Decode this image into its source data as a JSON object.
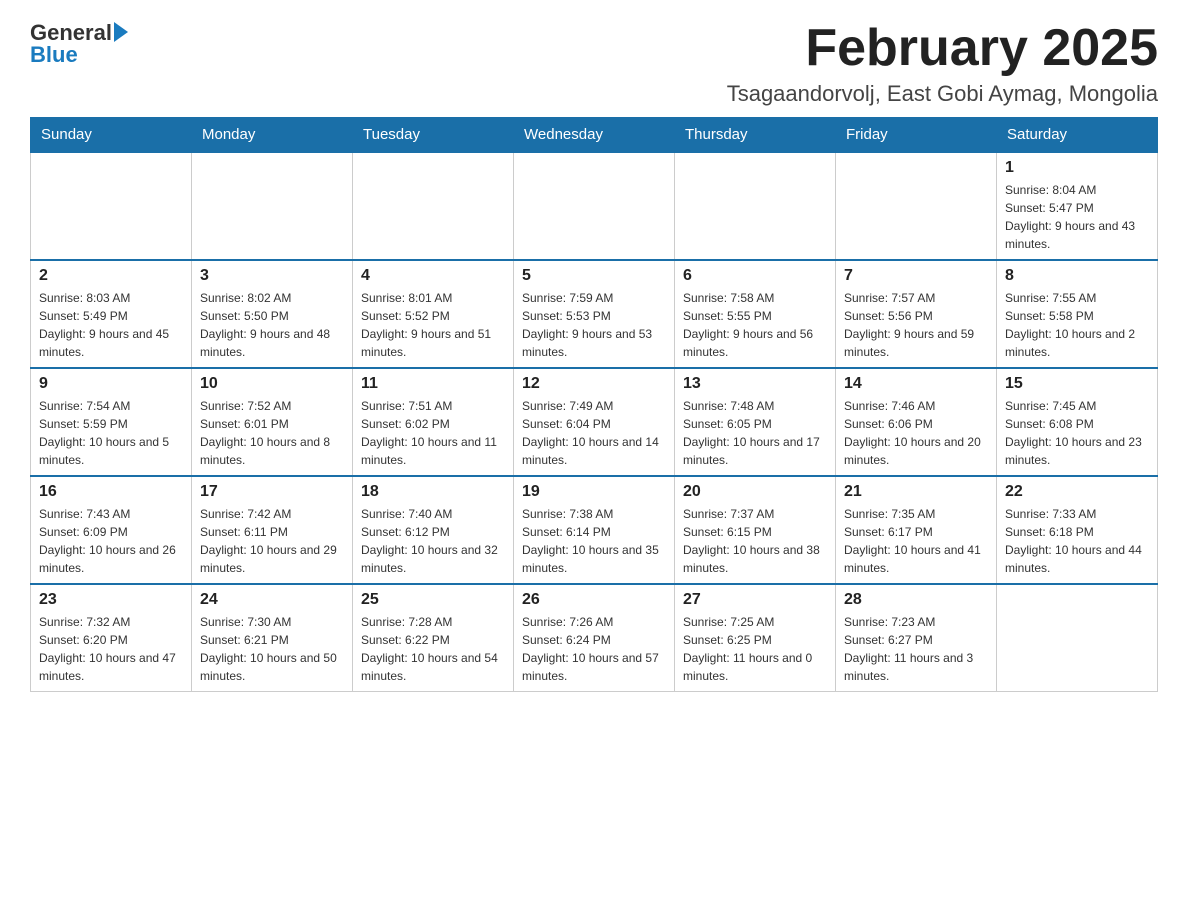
{
  "header": {
    "logo_text_general": "General",
    "logo_text_blue": "Blue",
    "month_title": "February 2025",
    "location": "Tsagaandorvolj, East Gobi Aymag, Mongolia"
  },
  "weekdays": [
    "Sunday",
    "Monday",
    "Tuesday",
    "Wednesday",
    "Thursday",
    "Friday",
    "Saturday"
  ],
  "weeks": [
    [
      {
        "day": "",
        "info": ""
      },
      {
        "day": "",
        "info": ""
      },
      {
        "day": "",
        "info": ""
      },
      {
        "day": "",
        "info": ""
      },
      {
        "day": "",
        "info": ""
      },
      {
        "day": "",
        "info": ""
      },
      {
        "day": "1",
        "info": "Sunrise: 8:04 AM\nSunset: 5:47 PM\nDaylight: 9 hours and 43 minutes."
      }
    ],
    [
      {
        "day": "2",
        "info": "Sunrise: 8:03 AM\nSunset: 5:49 PM\nDaylight: 9 hours and 45 minutes."
      },
      {
        "day": "3",
        "info": "Sunrise: 8:02 AM\nSunset: 5:50 PM\nDaylight: 9 hours and 48 minutes."
      },
      {
        "day": "4",
        "info": "Sunrise: 8:01 AM\nSunset: 5:52 PM\nDaylight: 9 hours and 51 minutes."
      },
      {
        "day": "5",
        "info": "Sunrise: 7:59 AM\nSunset: 5:53 PM\nDaylight: 9 hours and 53 minutes."
      },
      {
        "day": "6",
        "info": "Sunrise: 7:58 AM\nSunset: 5:55 PM\nDaylight: 9 hours and 56 minutes."
      },
      {
        "day": "7",
        "info": "Sunrise: 7:57 AM\nSunset: 5:56 PM\nDaylight: 9 hours and 59 minutes."
      },
      {
        "day": "8",
        "info": "Sunrise: 7:55 AM\nSunset: 5:58 PM\nDaylight: 10 hours and 2 minutes."
      }
    ],
    [
      {
        "day": "9",
        "info": "Sunrise: 7:54 AM\nSunset: 5:59 PM\nDaylight: 10 hours and 5 minutes."
      },
      {
        "day": "10",
        "info": "Sunrise: 7:52 AM\nSunset: 6:01 PM\nDaylight: 10 hours and 8 minutes."
      },
      {
        "day": "11",
        "info": "Sunrise: 7:51 AM\nSunset: 6:02 PM\nDaylight: 10 hours and 11 minutes."
      },
      {
        "day": "12",
        "info": "Sunrise: 7:49 AM\nSunset: 6:04 PM\nDaylight: 10 hours and 14 minutes."
      },
      {
        "day": "13",
        "info": "Sunrise: 7:48 AM\nSunset: 6:05 PM\nDaylight: 10 hours and 17 minutes."
      },
      {
        "day": "14",
        "info": "Sunrise: 7:46 AM\nSunset: 6:06 PM\nDaylight: 10 hours and 20 minutes."
      },
      {
        "day": "15",
        "info": "Sunrise: 7:45 AM\nSunset: 6:08 PM\nDaylight: 10 hours and 23 minutes."
      }
    ],
    [
      {
        "day": "16",
        "info": "Sunrise: 7:43 AM\nSunset: 6:09 PM\nDaylight: 10 hours and 26 minutes."
      },
      {
        "day": "17",
        "info": "Sunrise: 7:42 AM\nSunset: 6:11 PM\nDaylight: 10 hours and 29 minutes."
      },
      {
        "day": "18",
        "info": "Sunrise: 7:40 AM\nSunset: 6:12 PM\nDaylight: 10 hours and 32 minutes."
      },
      {
        "day": "19",
        "info": "Sunrise: 7:38 AM\nSunset: 6:14 PM\nDaylight: 10 hours and 35 minutes."
      },
      {
        "day": "20",
        "info": "Sunrise: 7:37 AM\nSunset: 6:15 PM\nDaylight: 10 hours and 38 minutes."
      },
      {
        "day": "21",
        "info": "Sunrise: 7:35 AM\nSunset: 6:17 PM\nDaylight: 10 hours and 41 minutes."
      },
      {
        "day": "22",
        "info": "Sunrise: 7:33 AM\nSunset: 6:18 PM\nDaylight: 10 hours and 44 minutes."
      }
    ],
    [
      {
        "day": "23",
        "info": "Sunrise: 7:32 AM\nSunset: 6:20 PM\nDaylight: 10 hours and 47 minutes."
      },
      {
        "day": "24",
        "info": "Sunrise: 7:30 AM\nSunset: 6:21 PM\nDaylight: 10 hours and 50 minutes."
      },
      {
        "day": "25",
        "info": "Sunrise: 7:28 AM\nSunset: 6:22 PM\nDaylight: 10 hours and 54 minutes."
      },
      {
        "day": "26",
        "info": "Sunrise: 7:26 AM\nSunset: 6:24 PM\nDaylight: 10 hours and 57 minutes."
      },
      {
        "day": "27",
        "info": "Sunrise: 7:25 AM\nSunset: 6:25 PM\nDaylight: 11 hours and 0 minutes."
      },
      {
        "day": "28",
        "info": "Sunrise: 7:23 AM\nSunset: 6:27 PM\nDaylight: 11 hours and 3 minutes."
      },
      {
        "day": "",
        "info": ""
      }
    ]
  ]
}
